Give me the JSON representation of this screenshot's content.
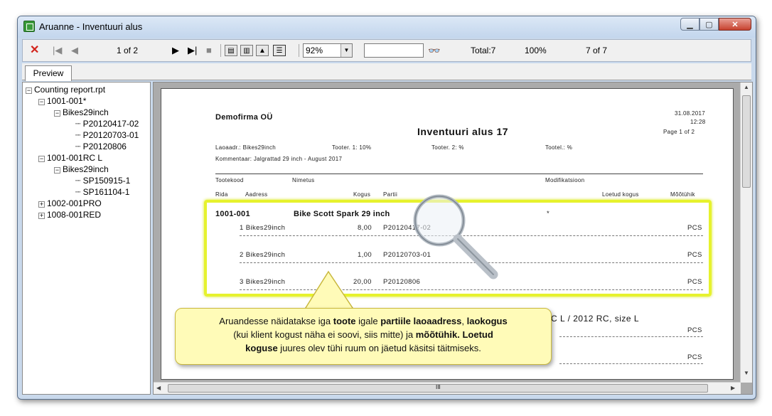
{
  "window": {
    "title": "Aruanne - Inventuuri alus"
  },
  "toolbar": {
    "page_indicator": "1 of 2",
    "zoom_value": "92%",
    "total": "Total:7",
    "percent": "100%",
    "count": "7 of 7",
    "search_value": ""
  },
  "tabs": [
    {
      "label": "Preview"
    }
  ],
  "tree": {
    "root": "Counting report.rpt",
    "n1": "1001-001*",
    "n1a": "Bikes29inch",
    "n1a1": "P20120417-02",
    "n1a2": "P20120703-01",
    "n1a3": "P20120806",
    "n2": "1001-001RC L",
    "n2a": "Bikes29inch",
    "n2a1": "SP150915-1",
    "n2a2": "SP161104-1",
    "n3": "1002-001PRO",
    "n4": "1008-001RED"
  },
  "report": {
    "company": "Demofirma OÜ",
    "title": "Inventuuri alus  17",
    "date": "31.08.2017",
    "time": "12:28",
    "page": "Page 1 of 2",
    "warehouse": "Laoaadr.: Bikes29inch",
    "tooter1": "Tooter. 1: 10%",
    "tooter2": "Tooter. 2: %",
    "tootel": "Tootel.: %",
    "comment": "Kommentaar: Jalgrattad 29 inch - August 2017",
    "col_code": "Tootekood",
    "col_name": "Nimetus",
    "col_mod": "Modifikatsioon",
    "col_row": "Rida",
    "col_addr": "Aadress",
    "col_qty": "Kogus",
    "col_batch": "Partii",
    "col_counted": "Loetud kogus",
    "col_unit": "Mõõtühik",
    "product1_code": "1001-001",
    "product1_name": "Bike Scott Spark 29 inch",
    "product1_mod": "*",
    "rows": [
      {
        "addr": "1 Bikes29inch",
        "qty": "8,00",
        "batch": "P20120417-02",
        "unit": "PCS"
      },
      {
        "addr": "2 Bikes29inch",
        "qty": "1,00",
        "batch": "P20120703-01",
        "unit": "PCS"
      },
      {
        "addr": "3 Bikes29inch",
        "qty": "20,00",
        "batch": "P20120806",
        "unit": "PCS"
      }
    ],
    "product2_partial": "C L / 2012 RC, size L",
    "extra_unit1": "PCS",
    "extra_unit2": "PCS"
  },
  "callout": {
    "t1": "Aruandesse näidatakse iga ",
    "b1": "toote",
    "t2": " igale ",
    "b2": "partiile laoaadress",
    "t3": ", ",
    "b3": "laokogus",
    "t4": "(kui klient kogust näha ei soovi, siis mitte) ja ",
    "b4": "mõõtühik.",
    "t5": " ",
    "b5": "Loetud",
    "b6": "koguse",
    "t6": " juures olev tühi ruum on jäetud käsitsi täitmiseks."
  },
  "colors": {
    "highlight": "#e6f22d",
    "callout_bg": "#fffbb8",
    "close_red": "#c7412e"
  },
  "scroll": {
    "h_label": "III"
  }
}
